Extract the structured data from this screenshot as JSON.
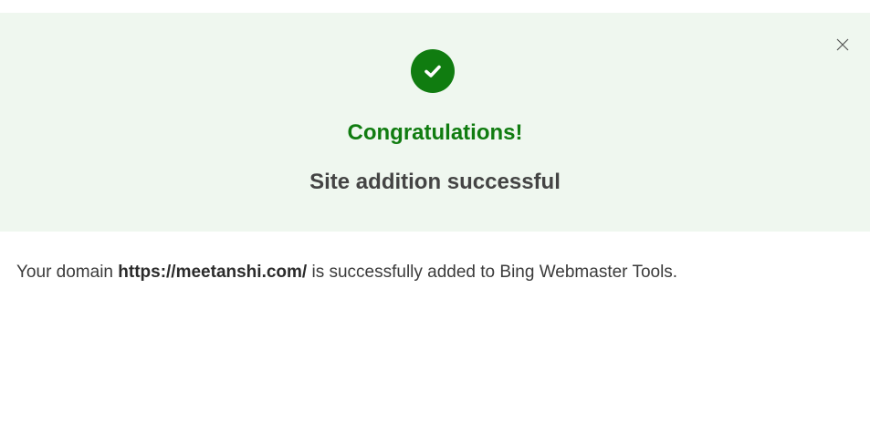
{
  "banner": {
    "title": "Congratulations!",
    "subtitle": "Site addition successful",
    "icon": "check-circle-icon",
    "accent_color": "#107c10",
    "background_color": "#eff7ef",
    "close_icon": "close-icon"
  },
  "message": {
    "prefix": "Your domain ",
    "domain": "https://meetanshi.com/",
    "suffix": " is successfully added to Bing Webmaster Tools."
  }
}
